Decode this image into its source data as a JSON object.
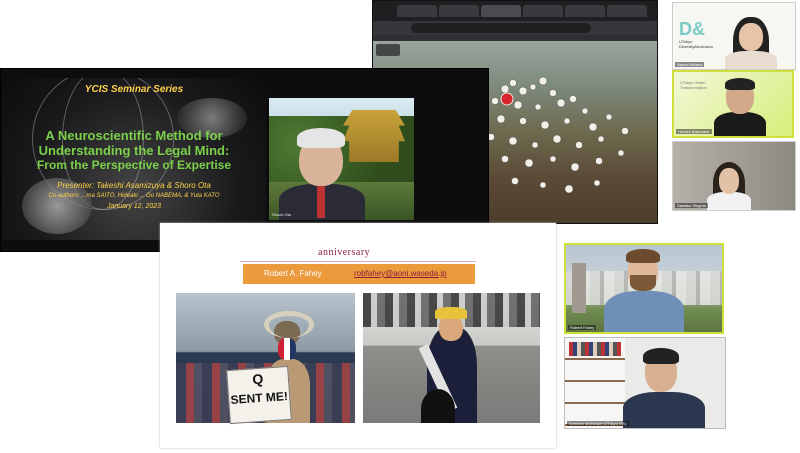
{
  "browser": {
    "tabs": [
      "",
      "",
      "",
      "",
      "",
      "",
      ""
    ],
    "url": "",
    "map_label": ""
  },
  "seminar_slide": {
    "series": "YCIS Seminar Series",
    "title_line1": "A Neuroscientific Method for",
    "title_line2": "Understanding the Legal Mind:",
    "title_line3": "From the Perspective of Expertise",
    "presenter": "Presenter: Takeshi Asamizuya & Shoro Ota",
    "coauthors": "Co-authors: ...ma SAITO, Hideaki ... Go NABEMA, & Yuta KATO",
    "date": "January 12, 2023"
  },
  "speaker_tile": {
    "name": "Shozo Ota"
  },
  "wias_slide": {
    "anniversary": "anniversary",
    "presenter_name": "Robert A. Fahey",
    "presenter_email": "robfahey@aoni.waseda.jp",
    "sign_line1": "Q",
    "sign_line2": "SENT ME!"
  },
  "participants": {
    "naomi": {
      "name": "Naomi Mikami",
      "logo": "D&",
      "logo_sub": "UTokyo Diversity&Inclusion"
    },
    "hiroshi": {
      "name": "Hiroshi Watanabe",
      "sub": "UTokyo Green Transformation"
    },
    "sawako": {
      "name": "Sawako Shigeta"
    },
    "robert": {
      "name": "Robert Fahey"
    },
    "kenneth": {
      "name": "Kenneth McElwain (UTokyo ISS)"
    }
  },
  "colors": {
    "slide_accent_title": "#7cd04a",
    "slide_accent_text": "#ffd24a",
    "wias_band": "#eb9a3c",
    "wias_maroon": "#8a1f3a",
    "active_speaker_border": "#cfe03a"
  }
}
